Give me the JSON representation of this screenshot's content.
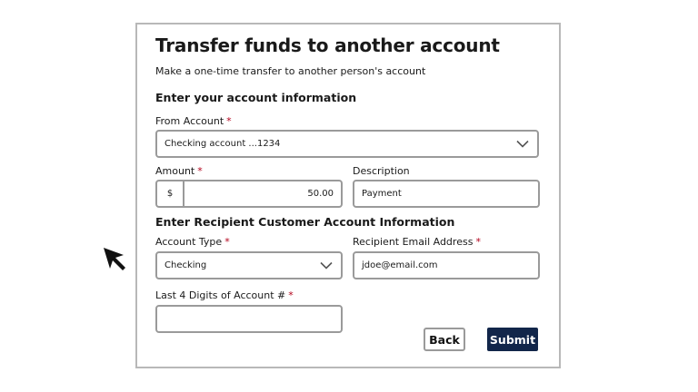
{
  "form": {
    "title": "Transfer funds to another account",
    "subtitle": "Make a one-time transfer to another person's account",
    "section_account": "Enter your account information",
    "from_account": {
      "label": "From Account",
      "required": "*",
      "value": "Checking account ...1234"
    },
    "amount": {
      "label": "Amount",
      "required": "*",
      "currency": "$",
      "value": "50.00"
    },
    "description": {
      "label": "Description",
      "value": "Payment"
    },
    "section_recipient": "Enter Recipient Customer Account Information",
    "account_type": {
      "label": "Account Type",
      "required": "*",
      "value": "Checking"
    },
    "recipient_email": {
      "label": "Recipient Email Address",
      "required": "*",
      "value": "jdoe@email.com"
    },
    "last4": {
      "label": "Last 4 Digits of Account #",
      "required": "*",
      "value": ""
    },
    "back_label": "Back",
    "submit_label": "Submit"
  },
  "colors": {
    "submit_bg": "#12264a",
    "required": "#b3001b",
    "border": "#9a9a9a"
  },
  "icons": {
    "select_chevron": "chevron-down-icon",
    "cursor": "mouse-pointer-icon"
  }
}
